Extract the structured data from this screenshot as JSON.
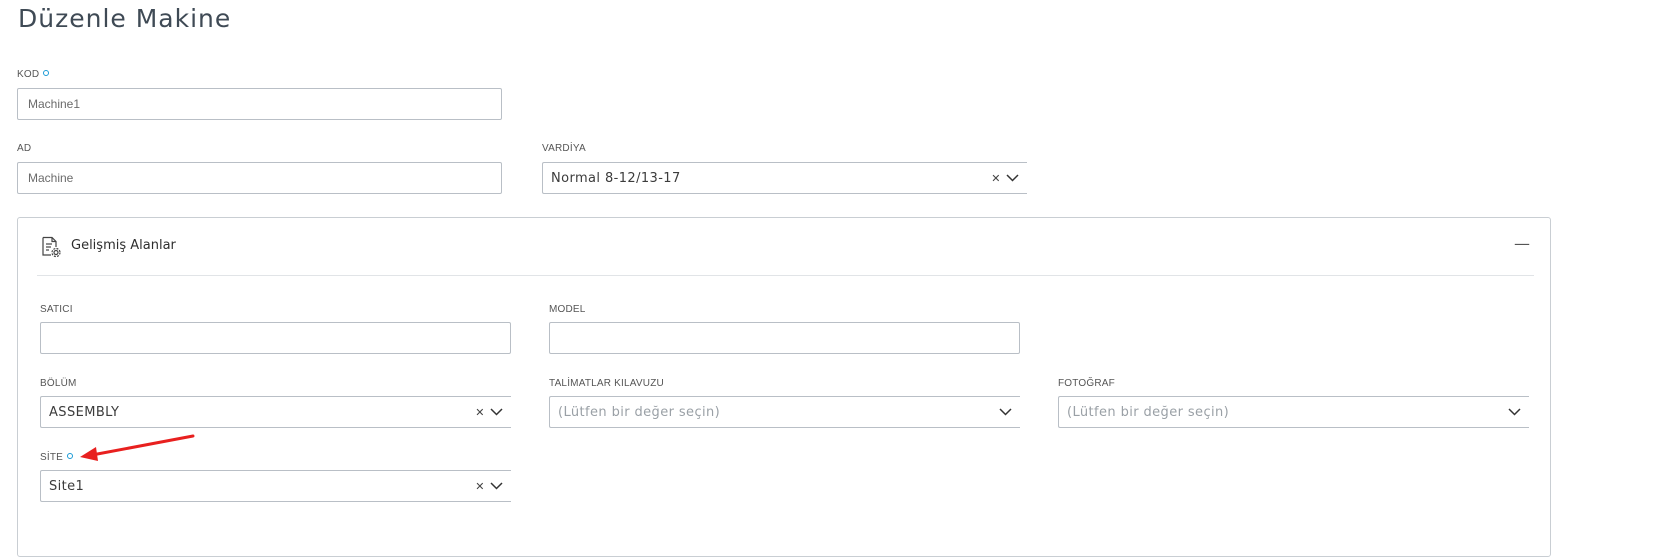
{
  "page": {
    "title": "Düzenle Makine"
  },
  "fields": {
    "kod": {
      "label": "KOD",
      "value": "Machine1"
    },
    "ad": {
      "label": "AD",
      "value": "Machine"
    },
    "vardiya": {
      "label": "VARDİYA",
      "value": "Normal 8-12/13-17"
    }
  },
  "advanced": {
    "title": "Gelişmiş Alanlar",
    "collapse_symbol": "—",
    "satici": {
      "label": "SATICI",
      "value": ""
    },
    "model": {
      "label": "MODEL",
      "value": ""
    },
    "bolum": {
      "label": "BÖLÜM",
      "value": "ASSEMBLY"
    },
    "talimatlar": {
      "label": "TALİMATLAR KILAVUZU",
      "placeholder": "(Lütfen bir değer seçin)"
    },
    "fotograf": {
      "label": "FOTOĞRAF",
      "placeholder": "(Lütfen bir değer seçin)"
    },
    "site": {
      "label": "SİTE",
      "value": "Site1"
    }
  },
  "icons": {
    "clear": "✕",
    "required_color": "#1a9ad6",
    "arrow_color": "#e8201f"
  }
}
